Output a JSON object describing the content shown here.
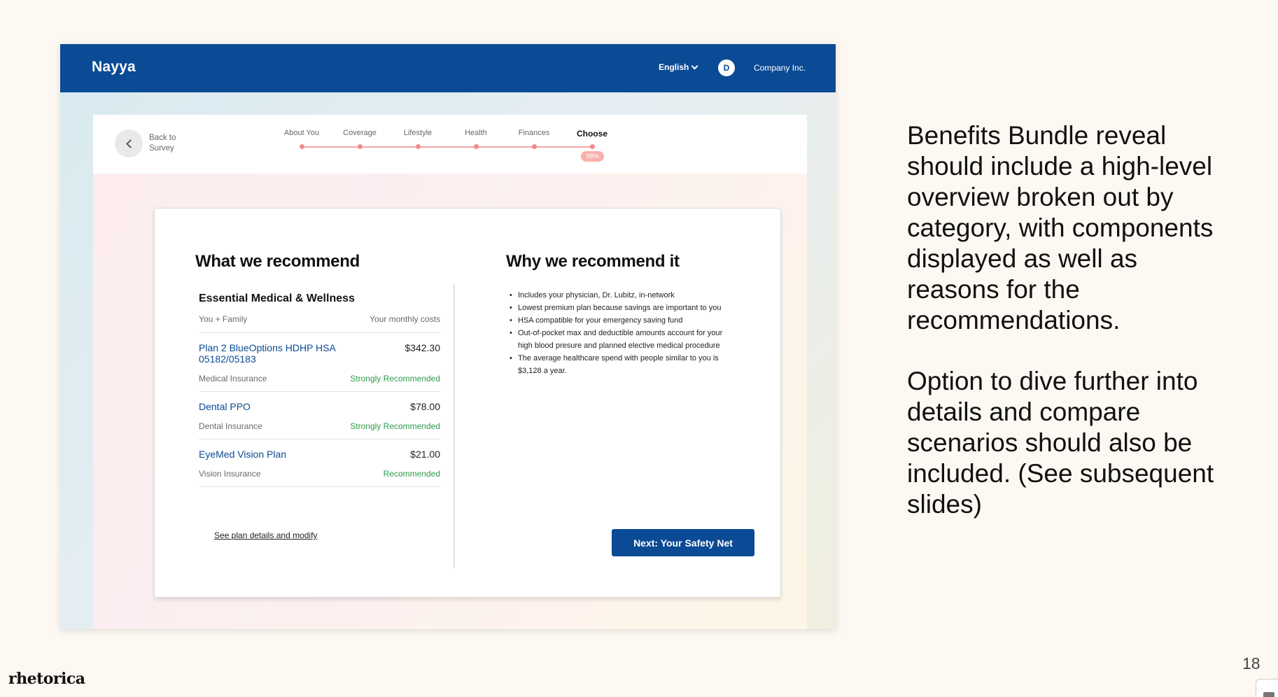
{
  "app": {
    "brand": "Nayya",
    "language": "English",
    "avatar_initial": "D",
    "company": "Company Inc."
  },
  "nav": {
    "back_label": "Back to Survey",
    "steps": [
      {
        "label": "About You"
      },
      {
        "label": "Coverage"
      },
      {
        "label": "Lifestyle"
      },
      {
        "label": "Health"
      },
      {
        "label": "Finances"
      },
      {
        "label": "Choose",
        "active": true
      }
    ],
    "progress_percent": "98%"
  },
  "recommend": {
    "title": "What we recommend",
    "category": "Essential Medical & Wellness",
    "coverage_label": "You + Family",
    "cost_label": "Your monthly costs",
    "plans": [
      {
        "name": "Plan 2 BlueOptions HDHP HSA 05182/05183",
        "price": "$342.30",
        "type": "Medical Insurance",
        "tag": "Strongly Recommended"
      },
      {
        "name": "Dental PPO",
        "price": "$78.00",
        "type": "Dental Insurance",
        "tag": "Strongly Recommended"
      },
      {
        "name": "EyeMed Vision Plan",
        "price": "$21.00",
        "type": "Vision Insurance",
        "tag": "Recommended"
      }
    ],
    "details_link": "See plan details and modify",
    "next_button": "Next: Your Safety Net"
  },
  "why": {
    "title": "Why we recommend it",
    "reasons": [
      "Includes your physician, Dr. Lubitz, in-network",
      "Lowest premium plan because savings are important to you",
      "HSA compatible for your emergency saving fund",
      "Out-of-pocket max and deductible amounts account for your high blood presure and planned elective medical procedure",
      "The average healthcare spend with people similar to you is $3,128 a year."
    ]
  },
  "slide": {
    "paragraph_1": "Benefits Bundle reveal should include a high-level overview broken out by category, with components displayed as well as reasons for the recommendations.",
    "paragraph_2": "Option to dive further into details and compare scenarios should also be included. (See subsequent slides)",
    "footer_logo": "rhetorica",
    "page_number": "18"
  },
  "colors": {
    "brand_blue": "#0b4a94",
    "recommend_green": "#2d9a4a",
    "progress_pink": "#f38a8a"
  }
}
